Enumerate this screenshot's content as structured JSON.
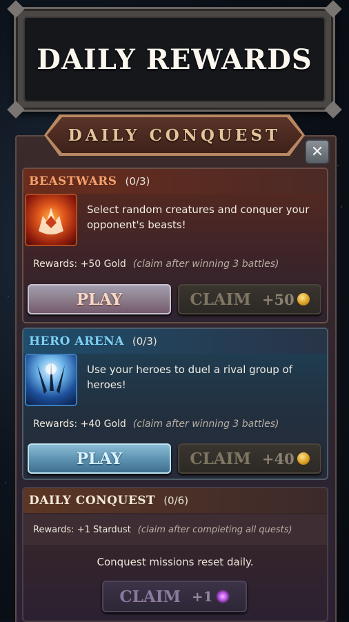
{
  "header": {
    "title": "DAILY REWARDS"
  },
  "banner": {
    "title": "DAILY CONQUEST"
  },
  "close": {
    "glyph": "✕"
  },
  "quests": [
    {
      "name": "BEASTWARS",
      "progress": "(0/3)",
      "description": "Select random creatures and conquer your opponent's beasts!",
      "rewards": "Rewards: +50 Gold",
      "note": "(claim after winning 3 battles)",
      "play_label": "PLAY",
      "claim_label": "CLAIM",
      "claim_amount": "+50"
    },
    {
      "name": "HERO ARENA",
      "progress": "(0/3)",
      "description": "Use your heroes to duel a rival group of heroes!",
      "rewards": "Rewards: +40 Gold",
      "note": "(claim after winning 3 battles)",
      "play_label": "PLAY",
      "claim_label": "CLAIM",
      "claim_amount": "+40"
    }
  ],
  "conquest": {
    "name": "DAILY CONQUEST",
    "progress": "(0/6)",
    "rewards": "Rewards: +1 Stardust",
    "note": "(claim after completing all quests)",
    "reset_text": "Conquest missions reset daily.",
    "claim_label": "CLAIM",
    "claim_amount": "+1"
  },
  "colors": {
    "beast_accent": "#f2a16b",
    "hero_accent": "#7fd0f2",
    "gold": "#d79b1e",
    "stardust": "#b248e0"
  }
}
